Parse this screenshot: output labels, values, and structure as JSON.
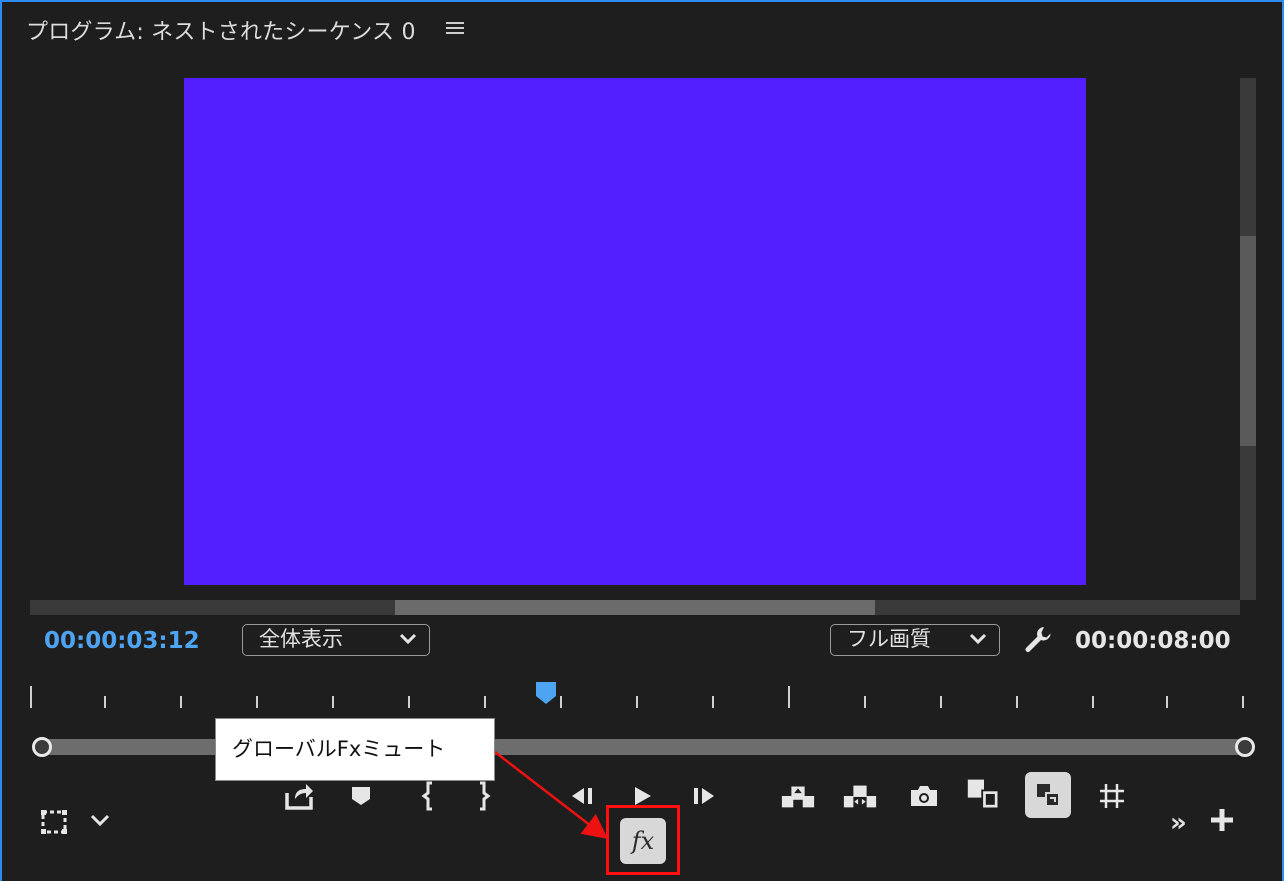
{
  "panel": {
    "title": "プログラム: ネストされたシーケンス 0",
    "menu_icon": "hamburger-icon"
  },
  "video": {
    "fill_color": "#541fff"
  },
  "timecodes": {
    "current": "00:00:03:12",
    "duration": "00:00:08:00"
  },
  "zoom": {
    "selected": "全体表示"
  },
  "quality": {
    "selected": "フル画質"
  },
  "transport": {
    "buttons": [
      "export-frame-icon",
      "add-marker-icon",
      "mark-in-icon",
      "mark-out-icon",
      "step-back-icon",
      "play-icon",
      "step-forward-icon",
      "lift-icon",
      "extract-icon",
      "camera-icon",
      "comparison-view-icon",
      "toggle-proxies-icon",
      "safe-margins-icon"
    ],
    "fx_label": "fx"
  },
  "bottom_left": {
    "icons": [
      "select-zoom-icon",
      "chevron-down-icon"
    ]
  },
  "bottom_right": {
    "overflow_label": "»",
    "add_icon": "plus-icon"
  },
  "annotation": {
    "label": "グローバルFxミュート",
    "highlight_color": "#ff1010"
  },
  "colors": {
    "accent": "#4ea4f1",
    "panel_border": "#2d8ceb",
    "background": "#1e1e1e"
  }
}
